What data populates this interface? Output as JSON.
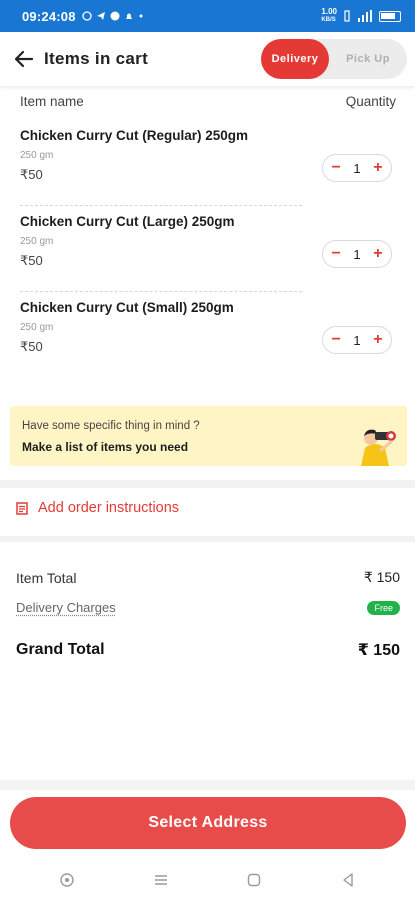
{
  "status_bar": {
    "time": "09:24:08",
    "net_speed": "1.00",
    "net_unit": "KB/S"
  },
  "header": {
    "title": "Items in cart"
  },
  "mode_toggle": {
    "delivery_label": "Delivery",
    "pickup_label": "Pick Up",
    "selected": "Delivery"
  },
  "list_header": {
    "name_col": "Item name",
    "qty_col": "Quantity"
  },
  "items": [
    {
      "name": "Chicken Curry Cut (Regular) 250gm",
      "weight": "250 gm",
      "price": "₹50",
      "qty": "1",
      "minus": "−",
      "plus": "+"
    },
    {
      "name": "Chicken Curry Cut (Large) 250gm",
      "weight": "250 gm",
      "price": "₹50",
      "qty": "1",
      "minus": "−",
      "plus": "+"
    },
    {
      "name": "Chicken Curry Cut (Small) 250gm",
      "weight": "250 gm",
      "price": "₹50",
      "qty": "1",
      "minus": "−",
      "plus": "+"
    }
  ],
  "banner": {
    "question": "Have some specific thing in mind ?",
    "cta": "Make a list of items you need"
  },
  "instructions": {
    "label": "Add order instructions"
  },
  "totals": {
    "item_total_label": "Item Total",
    "item_total_value": "₹ 150",
    "delivery_label": "Delivery Charges",
    "delivery_value": "Free",
    "grand_label": "Grand Total",
    "grand_value": "₹ 150"
  },
  "cta": {
    "label": "Select Address"
  },
  "colors": {
    "status_bar": "#1976d2",
    "accent": "#e53935",
    "cta": "#e84c4a",
    "banner_bg": "#fff5c4",
    "free_badge": "#21b24a"
  }
}
